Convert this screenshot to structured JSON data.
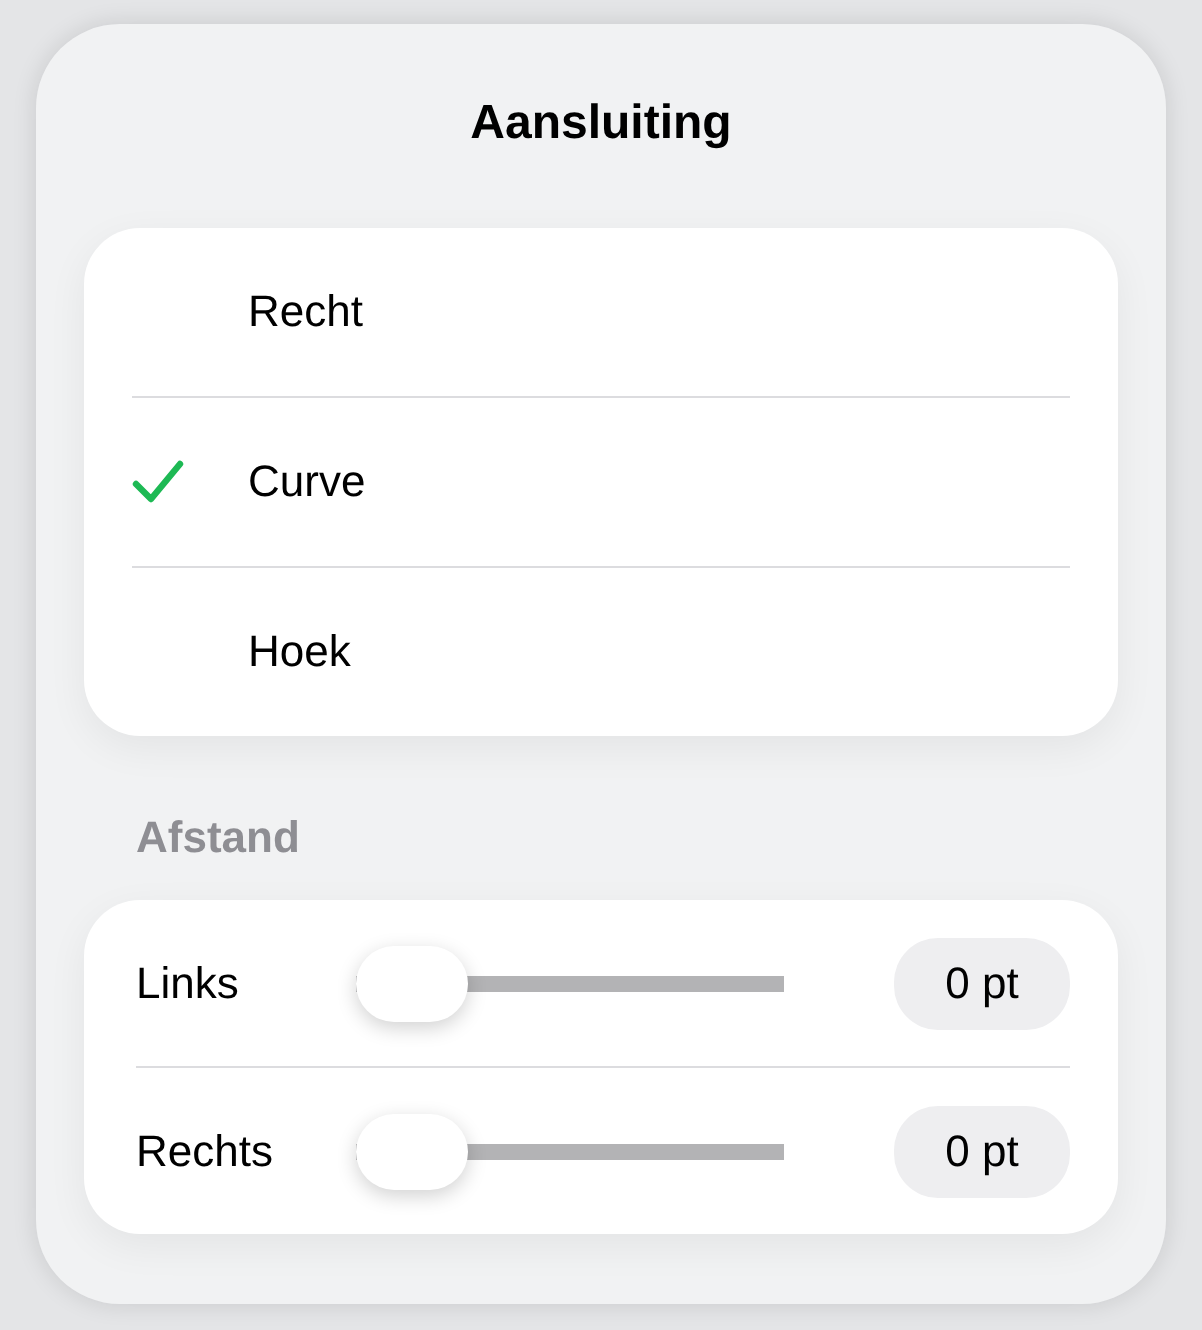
{
  "popover": {
    "title": "Aansluiting",
    "options": [
      {
        "label": "Recht",
        "selected": false
      },
      {
        "label": "Curve",
        "selected": true
      },
      {
        "label": "Hoek",
        "selected": false
      }
    ],
    "section_title": "Afstand",
    "sliders": [
      {
        "label": "Links",
        "level": 0,
        "reading": "0 pt"
      },
      {
        "label": "Rechts",
        "level": 0,
        "reading": "0 pt"
      }
    ]
  }
}
